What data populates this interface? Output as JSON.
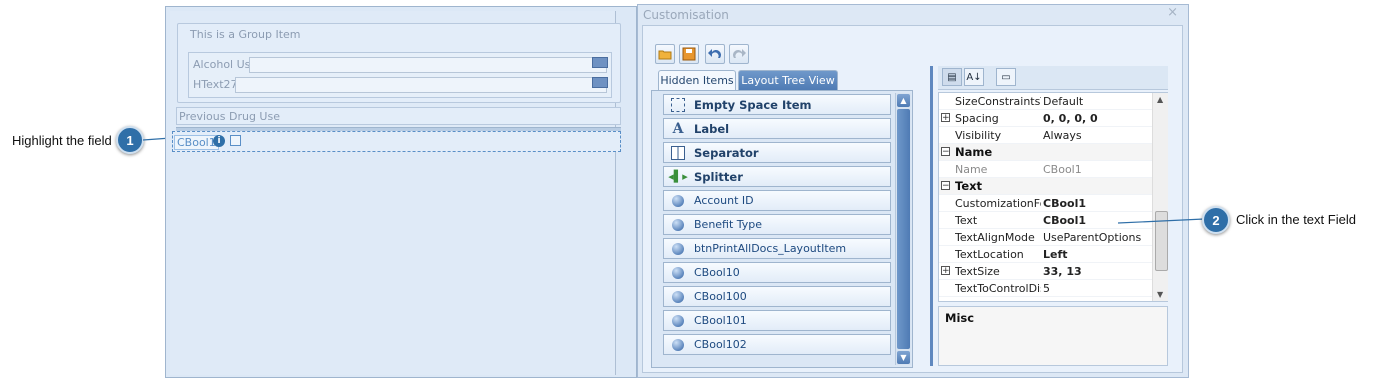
{
  "callouts": [
    {
      "number": "1",
      "text": "Highlight the field"
    },
    {
      "number": "2",
      "text": "Click in the text Field"
    }
  ],
  "designer": {
    "group_title": "This is a Group Item",
    "fields": [
      {
        "label": "Alcohol Use"
      },
      {
        "label": "HText27"
      }
    ],
    "previous_drug_use": "Previous Drug Use",
    "selected_item": "CBool1"
  },
  "customisation": {
    "title": "Customisation",
    "close": "×",
    "tabs": [
      "Hidden Items",
      "Layout Tree View"
    ],
    "active_tab": "Hidden Items",
    "items": [
      {
        "label": "Empty Space Item",
        "icon": "empty-space-icon",
        "bold": true
      },
      {
        "label": "Label",
        "icon": "label-icon",
        "bold": true
      },
      {
        "label": "Separator",
        "icon": "separator-icon",
        "bold": true
      },
      {
        "label": "Splitter",
        "icon": "splitter-icon",
        "bold": true
      },
      {
        "label": "Account ID",
        "icon": "field-icon",
        "bold": false
      },
      {
        "label": "Benefit Type",
        "icon": "field-icon",
        "bold": false
      },
      {
        "label": "btnPrintAllDocs_LayoutItem",
        "icon": "field-icon",
        "bold": false
      },
      {
        "label": "CBool10",
        "icon": "field-icon",
        "bold": false
      },
      {
        "label": "CBool100",
        "icon": "field-icon",
        "bold": false
      },
      {
        "label": "CBool101",
        "icon": "field-icon",
        "bold": false
      },
      {
        "label": "CBool102",
        "icon": "field-icon",
        "bold": false
      }
    ],
    "properties": [
      {
        "type": "row",
        "name": "SizeConstraintsType",
        "value": "Default"
      },
      {
        "type": "row",
        "name": "Spacing",
        "value": "0, 0, 0, 0",
        "bold": true,
        "expander": "+"
      },
      {
        "type": "row",
        "name": "Visibility",
        "value": "Always"
      },
      {
        "type": "cat",
        "name": "Name",
        "expander": "−"
      },
      {
        "type": "row",
        "name": "Name",
        "value": "CBool1",
        "grey": true
      },
      {
        "type": "cat",
        "name": "Text",
        "expander": "−"
      },
      {
        "type": "row",
        "name": "CustomizationFormText",
        "value": "CBool1",
        "bold": true
      },
      {
        "type": "row",
        "name": "Text",
        "value": "CBool1",
        "bold": true
      },
      {
        "type": "row",
        "name": "TextAlignMode",
        "value": "UseParentOptions"
      },
      {
        "type": "row",
        "name": "TextLocation",
        "value": "Left",
        "bold": true
      },
      {
        "type": "row",
        "name": "TextSize",
        "value": "33, 13",
        "bold": true,
        "expander": "+"
      },
      {
        "type": "row",
        "name": "TextToControlDistance",
        "value": "5"
      }
    ],
    "description_title": "Misc"
  },
  "colors": {
    "accent": "#2f6fa8",
    "tab_inactive": "#4f7bb4",
    "panel": "#dde8f5"
  }
}
